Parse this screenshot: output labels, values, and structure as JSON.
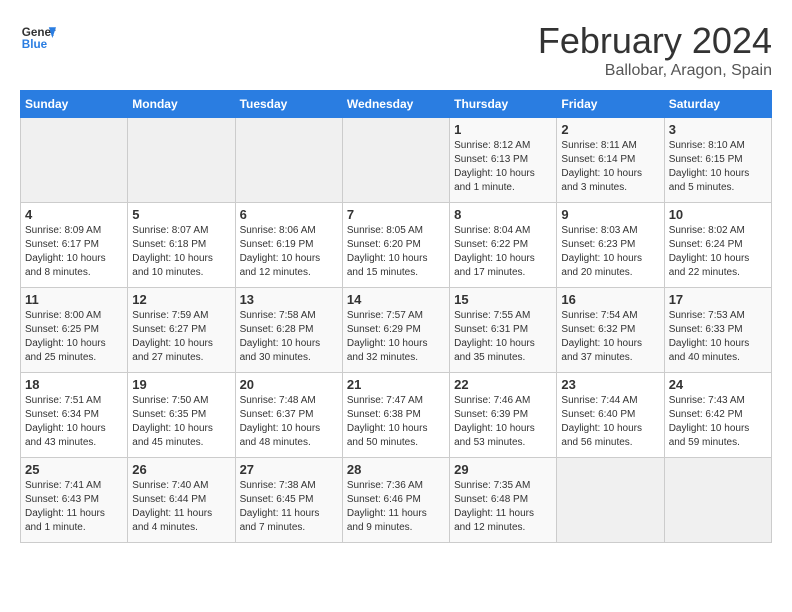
{
  "logo": {
    "line1": "General",
    "line2": "Blue"
  },
  "title": "February 2024",
  "subtitle": "Ballobar, Aragon, Spain",
  "days_of_week": [
    "Sunday",
    "Monday",
    "Tuesday",
    "Wednesday",
    "Thursday",
    "Friday",
    "Saturday"
  ],
  "weeks": [
    [
      {
        "day": "",
        "info": ""
      },
      {
        "day": "",
        "info": ""
      },
      {
        "day": "",
        "info": ""
      },
      {
        "day": "",
        "info": ""
      },
      {
        "day": "1",
        "info": "Sunrise: 8:12 AM\nSunset: 6:13 PM\nDaylight: 10 hours and 1 minute."
      },
      {
        "day": "2",
        "info": "Sunrise: 8:11 AM\nSunset: 6:14 PM\nDaylight: 10 hours and 3 minutes."
      },
      {
        "day": "3",
        "info": "Sunrise: 8:10 AM\nSunset: 6:15 PM\nDaylight: 10 hours and 5 minutes."
      }
    ],
    [
      {
        "day": "4",
        "info": "Sunrise: 8:09 AM\nSunset: 6:17 PM\nDaylight: 10 hours and 8 minutes."
      },
      {
        "day": "5",
        "info": "Sunrise: 8:07 AM\nSunset: 6:18 PM\nDaylight: 10 hours and 10 minutes."
      },
      {
        "day": "6",
        "info": "Sunrise: 8:06 AM\nSunset: 6:19 PM\nDaylight: 10 hours and 12 minutes."
      },
      {
        "day": "7",
        "info": "Sunrise: 8:05 AM\nSunset: 6:20 PM\nDaylight: 10 hours and 15 minutes."
      },
      {
        "day": "8",
        "info": "Sunrise: 8:04 AM\nSunset: 6:22 PM\nDaylight: 10 hours and 17 minutes."
      },
      {
        "day": "9",
        "info": "Sunrise: 8:03 AM\nSunset: 6:23 PM\nDaylight: 10 hours and 20 minutes."
      },
      {
        "day": "10",
        "info": "Sunrise: 8:02 AM\nSunset: 6:24 PM\nDaylight: 10 hours and 22 minutes."
      }
    ],
    [
      {
        "day": "11",
        "info": "Sunrise: 8:00 AM\nSunset: 6:25 PM\nDaylight: 10 hours and 25 minutes."
      },
      {
        "day": "12",
        "info": "Sunrise: 7:59 AM\nSunset: 6:27 PM\nDaylight: 10 hours and 27 minutes."
      },
      {
        "day": "13",
        "info": "Sunrise: 7:58 AM\nSunset: 6:28 PM\nDaylight: 10 hours and 30 minutes."
      },
      {
        "day": "14",
        "info": "Sunrise: 7:57 AM\nSunset: 6:29 PM\nDaylight: 10 hours and 32 minutes."
      },
      {
        "day": "15",
        "info": "Sunrise: 7:55 AM\nSunset: 6:31 PM\nDaylight: 10 hours and 35 minutes."
      },
      {
        "day": "16",
        "info": "Sunrise: 7:54 AM\nSunset: 6:32 PM\nDaylight: 10 hours and 37 minutes."
      },
      {
        "day": "17",
        "info": "Sunrise: 7:53 AM\nSunset: 6:33 PM\nDaylight: 10 hours and 40 minutes."
      }
    ],
    [
      {
        "day": "18",
        "info": "Sunrise: 7:51 AM\nSunset: 6:34 PM\nDaylight: 10 hours and 43 minutes."
      },
      {
        "day": "19",
        "info": "Sunrise: 7:50 AM\nSunset: 6:35 PM\nDaylight: 10 hours and 45 minutes."
      },
      {
        "day": "20",
        "info": "Sunrise: 7:48 AM\nSunset: 6:37 PM\nDaylight: 10 hours and 48 minutes."
      },
      {
        "day": "21",
        "info": "Sunrise: 7:47 AM\nSunset: 6:38 PM\nDaylight: 10 hours and 50 minutes."
      },
      {
        "day": "22",
        "info": "Sunrise: 7:46 AM\nSunset: 6:39 PM\nDaylight: 10 hours and 53 minutes."
      },
      {
        "day": "23",
        "info": "Sunrise: 7:44 AM\nSunset: 6:40 PM\nDaylight: 10 hours and 56 minutes."
      },
      {
        "day": "24",
        "info": "Sunrise: 7:43 AM\nSunset: 6:42 PM\nDaylight: 10 hours and 59 minutes."
      }
    ],
    [
      {
        "day": "25",
        "info": "Sunrise: 7:41 AM\nSunset: 6:43 PM\nDaylight: 11 hours and 1 minute."
      },
      {
        "day": "26",
        "info": "Sunrise: 7:40 AM\nSunset: 6:44 PM\nDaylight: 11 hours and 4 minutes."
      },
      {
        "day": "27",
        "info": "Sunrise: 7:38 AM\nSunset: 6:45 PM\nDaylight: 11 hours and 7 minutes."
      },
      {
        "day": "28",
        "info": "Sunrise: 7:36 AM\nSunset: 6:46 PM\nDaylight: 11 hours and 9 minutes."
      },
      {
        "day": "29",
        "info": "Sunrise: 7:35 AM\nSunset: 6:48 PM\nDaylight: 11 hours and 12 minutes."
      },
      {
        "day": "",
        "info": ""
      },
      {
        "day": "",
        "info": ""
      }
    ]
  ]
}
